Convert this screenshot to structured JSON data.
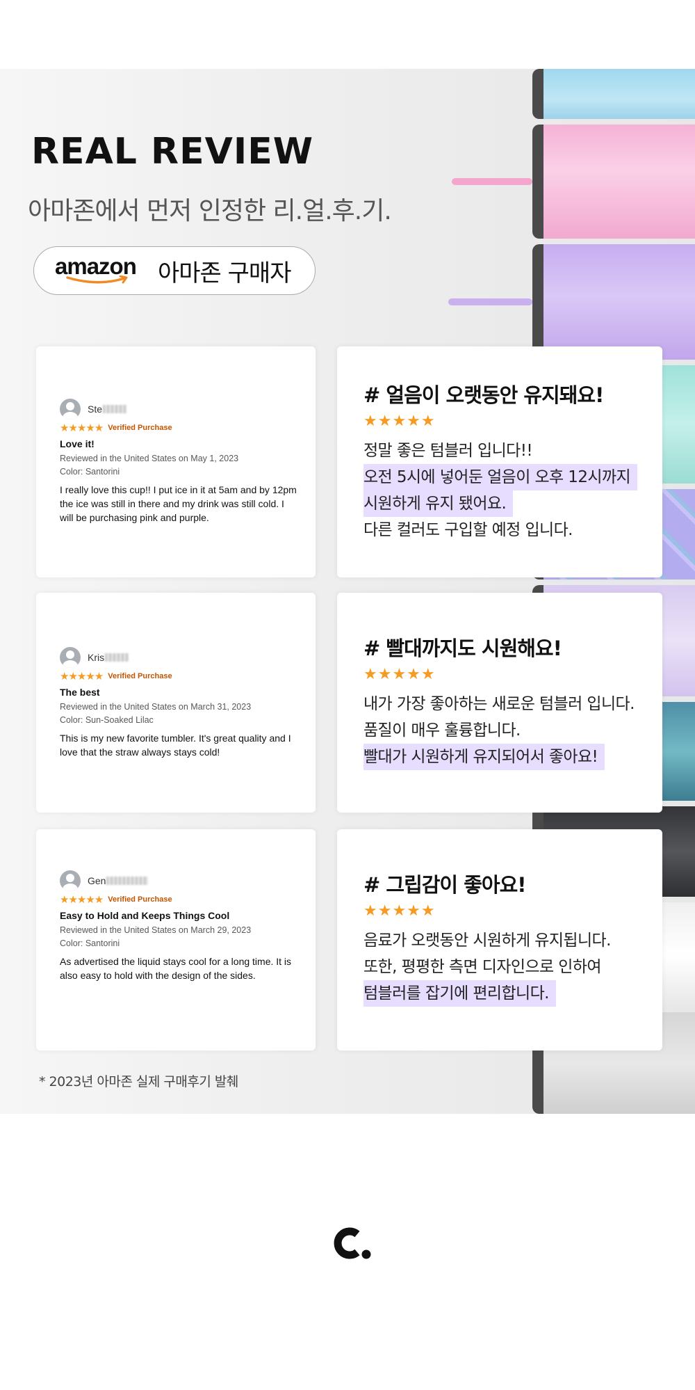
{
  "header": {
    "title": "REAL REVIEW",
    "subtitle": "아마존에서 먼저 인정한 리.얼.후.기.",
    "badge_logo": "amazon",
    "badge_label": "아마존 구매자"
  },
  "reviews": [
    {
      "name": "Ste",
      "stars": "★★★★★",
      "verified": "Verified Purchase",
      "title": "Love it!",
      "date": "Reviewed in the United States on May 1, 2023",
      "color": "Color: Santorini",
      "body": "I really love this cup!! I put ice in it at 5am and by 12pm the ice was still in there and my drink was still cold. I will be purchasing pink and purple.",
      "kr_head": "# 얼음이 오랫동안 유지돼요!",
      "kr_stars": "★★★★★",
      "kr_lines": [
        "정말 좋은 텀블러 입니다!!",
        "오전 5시에 넣어둔 얼음이 오후 12시까지",
        "시원하게 유지 됐어요.",
        "다른 컬러도 구입할 예정 입니다."
      ]
    },
    {
      "name": "Kris",
      "stars": "★★★★★",
      "verified": "Verified Purchase",
      "title": "The best",
      "date": "Reviewed in the United States on March 31, 2023",
      "color": "Color: Sun-Soaked Lilac",
      "body": "This is my new favorite tumbler. It's great quality and I love that the straw always stays cold!",
      "kr_head": "# 빨대까지도 시원해요!",
      "kr_stars": "★★★★★",
      "kr_lines": [
        "내가 가장 좋아하는 새로운 텀블러 입니다.",
        "품질이 매우 훌륭합니다.",
        "빨대가 시원하게 유지되어서 좋아요!"
      ]
    },
    {
      "name": "Gen",
      "stars": "★★★★★",
      "verified": "Verified Purchase",
      "title": "Easy to Hold and Keeps Things Cool",
      "date": "Reviewed in the United States on March 29, 2023",
      "color": "Color: Santorini",
      "body": "As advertised the liquid stays cool for a long time. It is also easy to hold with the design of the sides.",
      "kr_head": "# 그립감이 좋아요!",
      "kr_stars": "★★★★★",
      "kr_lines": [
        "음료가 오랫동안 시원하게 유지됩니다.",
        "또한, 평평한 측면 디자인으로 인하여",
        "텀블러를 잡기에 편리합니다."
      ]
    }
  ],
  "footnote": "* 2023년 아마존 실제 구매후기 발췌",
  "colors": {
    "highlight": "#e6ddff",
    "star": "#f59b22",
    "verified": "#c45500",
    "tumblers": [
      "#a9dcef",
      "#f7b7d9",
      "#cdb4ee",
      "#a8e6df",
      "#b7b1f0",
      "#ddd1ef",
      "#5aa3b0",
      "#3a3a3e",
      "#f2f2f2",
      "#d8d8d8"
    ]
  },
  "icons": [
    "avatar-icon",
    "star-icon",
    "amazon-smile-icon",
    "brand-logo-icon"
  ]
}
